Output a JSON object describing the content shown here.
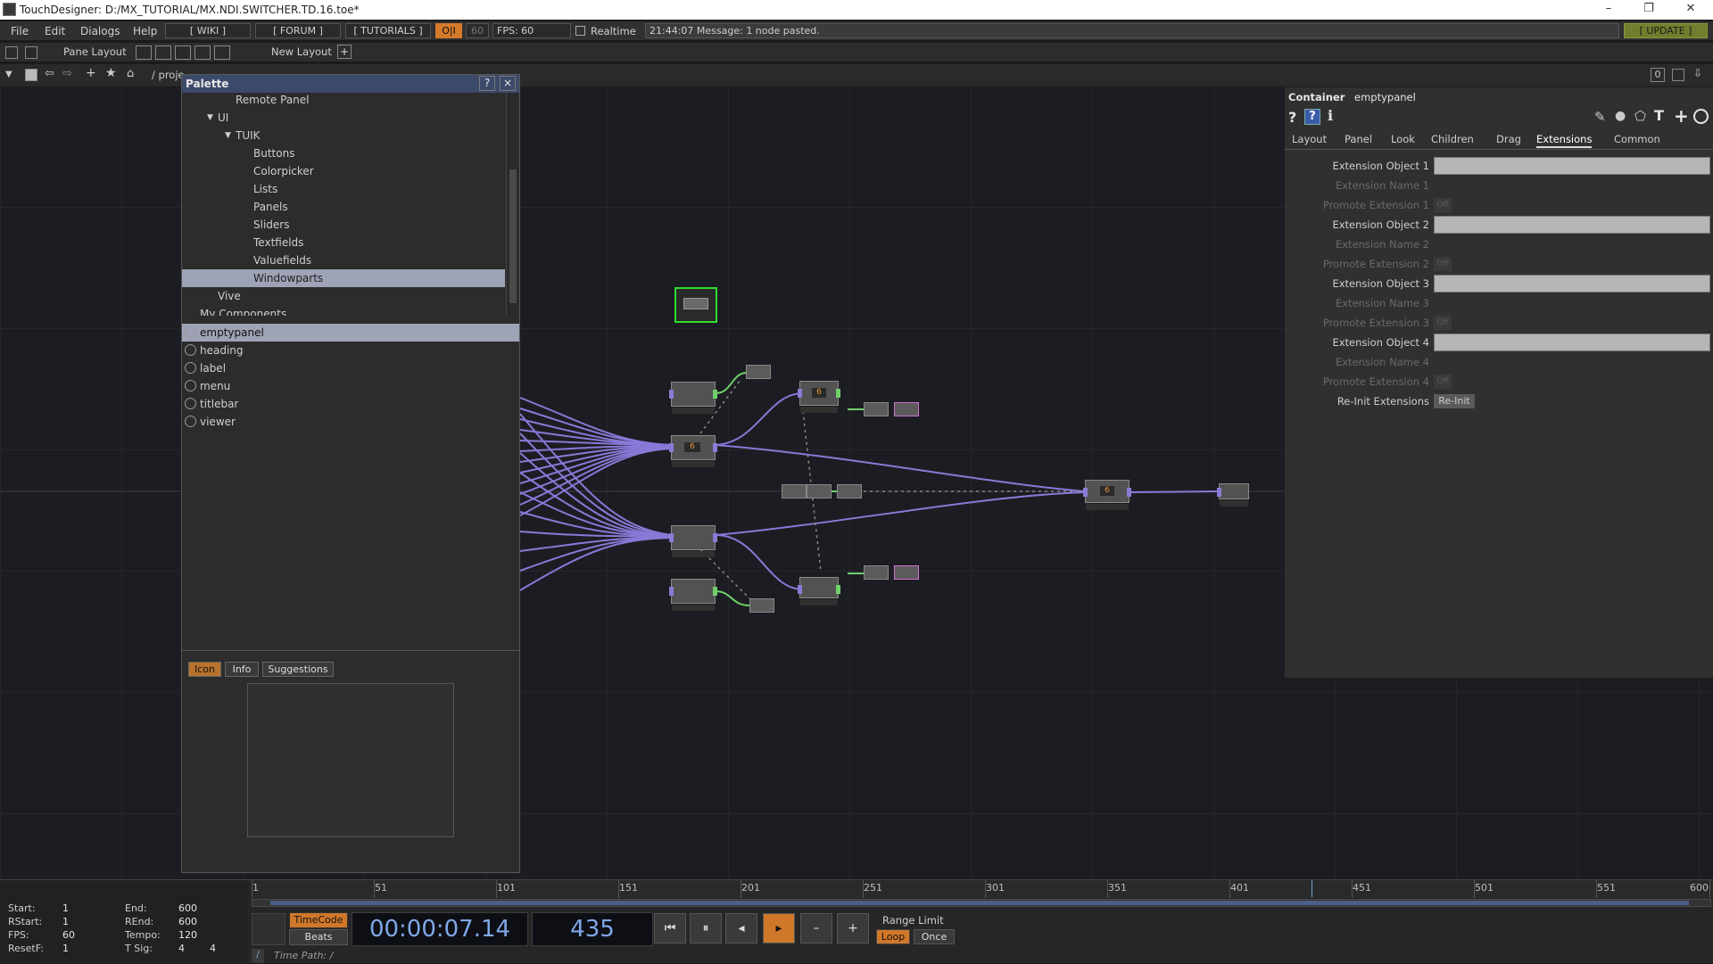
{
  "window": {
    "title": "TouchDesigner: D:/MX_TUTORIAL/MX.NDI.SWITCHER.TD.16.toe*",
    "min": "–",
    "restore": "❐",
    "close": "✕"
  },
  "menu": {
    "items": [
      "File",
      "Edit",
      "Dialogs",
      "Help"
    ],
    "wiki": "[ WIKI ]",
    "forum": "[ FORUM ]",
    "tutorials": "[ TUTORIALS ]",
    "oi": "O|I",
    "fps_val": "60",
    "fps": "FPS:  60",
    "realtime": "Realtime",
    "message": "21:44:07 Message: 1 node pasted.",
    "update": "[ UPDATE ]"
  },
  "bar2": {
    "pane_layout": "Pane Layout",
    "new_layout": "New Layout",
    "plus": "+"
  },
  "bar3": {
    "path": "/ proje",
    "zero": "0"
  },
  "palette": {
    "title": "Palette",
    "help": "?",
    "close": "×",
    "tree": [
      {
        "label": "Remote Panel",
        "indent": 60
      },
      {
        "label": "UI",
        "indent": 40,
        "arrow": true
      },
      {
        "label": "TUIK",
        "indent": 60,
        "arrow": true
      },
      {
        "label": "Buttons",
        "indent": 80
      },
      {
        "label": "Colorpicker",
        "indent": 80
      },
      {
        "label": "Lists",
        "indent": 80
      },
      {
        "label": "Panels",
        "indent": 80
      },
      {
        "label": "Sliders",
        "indent": 80
      },
      {
        "label": "Textfields",
        "indent": 80
      },
      {
        "label": "Valuefields",
        "indent": 80
      },
      {
        "label": "Windowparts",
        "indent": 80,
        "selected": true
      },
      {
        "label": "Vive",
        "indent": 40
      },
      {
        "label": "My Components",
        "indent": 20
      }
    ],
    "components": [
      {
        "label": "emptypanel",
        "selected": true
      },
      {
        "label": "heading"
      },
      {
        "label": "label"
      },
      {
        "label": "menu"
      },
      {
        "label": "titlebar"
      },
      {
        "label": "viewer"
      }
    ],
    "tabs": {
      "icon": "Icon",
      "info": "Info",
      "suggestions": "Suggestions"
    }
  },
  "params": {
    "type": "Container",
    "name": "emptypanel",
    "tabs": [
      "Layout",
      "Panel",
      "Look",
      "Children",
      "Drag",
      "Extensions",
      "Common"
    ],
    "active_tab": "Extensions",
    "rows": [
      {
        "label": "Extension Object 1",
        "kind": "field"
      },
      {
        "label": "Extension Name 1",
        "kind": "dim"
      },
      {
        "label": "Promote Extension 1",
        "kind": "toggle"
      },
      {
        "label": "Extension Object 2",
        "kind": "field"
      },
      {
        "label": "Extension Name 2",
        "kind": "dim"
      },
      {
        "label": "Promote Extension 2",
        "kind": "toggle"
      },
      {
        "label": "Extension Object 3",
        "kind": "field"
      },
      {
        "label": "Extension Name 3",
        "kind": "dim"
      },
      {
        "label": "Promote Extension 3",
        "kind": "toggle"
      },
      {
        "label": "Extension Object 4",
        "kind": "field"
      },
      {
        "label": "Extension Name 4",
        "kind": "dim"
      },
      {
        "label": "Promote Extension 4",
        "kind": "toggle"
      },
      {
        "label": "Re-Init Extensions",
        "kind": "button"
      }
    ],
    "toggle_label": "Off",
    "reinit_label": "Re-Init"
  },
  "timeline": {
    "labels": {
      "start": "Start:",
      "end": "End:",
      "rstart": "RStart:",
      "rend": "REnd:",
      "fps": "FPS:",
      "tempo": "Tempo:",
      "resetf": "ResetF:",
      "tsig": "T Sig:"
    },
    "values": {
      "start": "1",
      "end": "600",
      "rstart": "1",
      "rend": "600",
      "fps": "60",
      "tempo": "120",
      "resetf": "1",
      "tsig": "4        4"
    },
    "timecode": "TimeCode",
    "beats": "Beats",
    "time": "00:00:07.14",
    "frame": "435",
    "range_limit": "Range Limit",
    "loop": "Loop",
    "once": "Once",
    "time_path": "Time Path: /",
    "ruler": [
      "1",
      "51",
      "101",
      "151",
      "201",
      "251",
      "301",
      "351",
      "401",
      "451",
      "501",
      "551",
      "600"
    ],
    "minus": "–",
    "plus": "+",
    "rewind": "⏮",
    "pause": "⏸",
    "step_back": "◂",
    "play": "▸"
  }
}
